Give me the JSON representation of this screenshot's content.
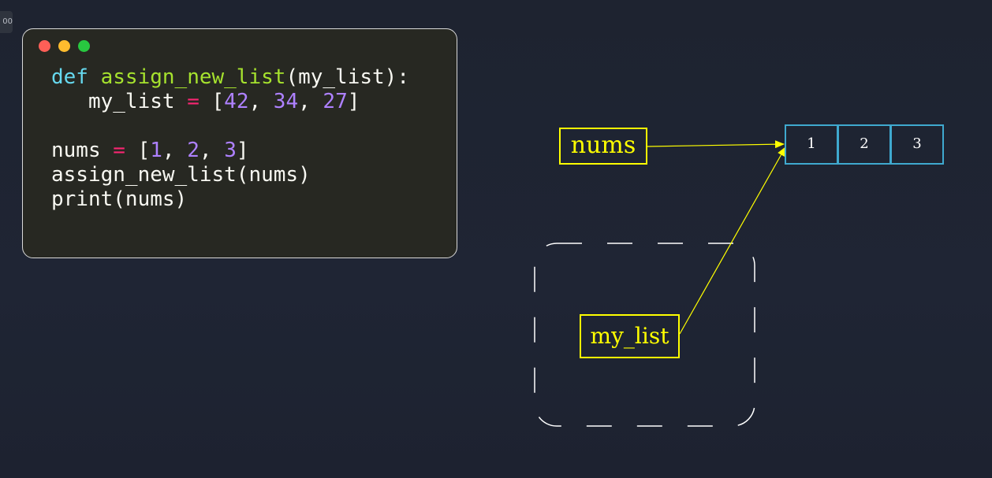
{
  "colors": {
    "background": "#1f2433",
    "code_bg": "#272822",
    "dot_red": "#fe5f57",
    "dot_yellow": "#febc2e",
    "dot_green": "#28c840",
    "keyword": "#66d9ef",
    "function": "#a6e22e",
    "operator": "#f92672",
    "number": "#ae81ff",
    "text": "#f8f8f2",
    "label": "#ffff00",
    "list_border": "#3fa9cf",
    "frame_border": "#ffffff"
  },
  "corner_tag": "00",
  "code": {
    "line1": {
      "kw": "def",
      "fn": "assign_new_list",
      "rest": "(my_list):"
    },
    "line2": {
      "indent": "   ",
      "var": "my_list",
      "op": "=",
      "open": "[",
      "n1": "42",
      "sep1": ", ",
      "n2": "34",
      "sep2": ", ",
      "n3": "27",
      "close": "]"
    },
    "line4": {
      "var": "nums",
      "op": "=",
      "open": "[",
      "n1": "1",
      "sep1": ", ",
      "n2": "2",
      "sep2": ", ",
      "n3": "3",
      "close": "]"
    },
    "line5": "assign_new_list(nums)",
    "line6": "print(nums)"
  },
  "diagram": {
    "nums_label": "nums",
    "mylist_label": "my_list",
    "list_values": [
      "1",
      "2",
      "3"
    ]
  }
}
